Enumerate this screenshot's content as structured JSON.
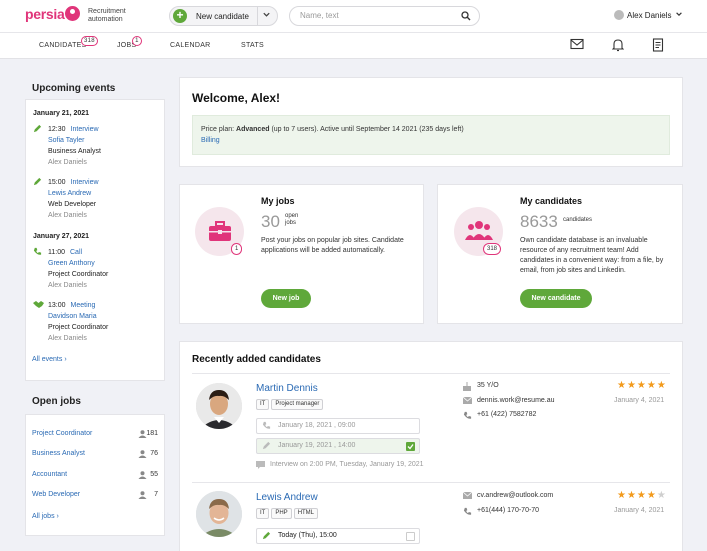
{
  "brand": {
    "logo": "persia",
    "subtitle": "Recruitment automation",
    "color": "#e0357a"
  },
  "header": {
    "new_candidate_label": "New candidate",
    "search_placeholder": "Name, text",
    "user_name": "Alex Daniels"
  },
  "nav": {
    "candidates": {
      "label": "CANDIDATES",
      "badge": "318"
    },
    "jobs": {
      "label": "JOBS",
      "badge": "1"
    },
    "calendar": {
      "label": "CALENDAR"
    },
    "stats": {
      "label": "STATS"
    },
    "icons": [
      "mail-icon",
      "bell-icon",
      "report-icon"
    ]
  },
  "events": {
    "title": "Upcoming events",
    "groups": [
      {
        "date": "January 21, 2021",
        "items": [
          {
            "time": "12:30",
            "type": "Interview",
            "who": "Sofia Tayler",
            "position": "Business Analyst",
            "owner": "Alex Daniels",
            "icon": "pencil-icon"
          },
          {
            "time": "15:00",
            "type": "Interview",
            "who": "Lewis Andrew",
            "position": "Web Developer",
            "owner": "Alex Daniels",
            "icon": "pencil-icon"
          }
        ]
      },
      {
        "date": "January 27, 2021",
        "items": [
          {
            "time": "11:00",
            "type": "Call",
            "who": "Green Anthony",
            "position": "Project Coordinator",
            "owner": "Alex Daniels",
            "icon": "phone-icon"
          },
          {
            "time": "13:00",
            "type": "Meeting",
            "who": "Davidson Maria",
            "position": "Project Coordinator",
            "owner": "Alex Daniels",
            "icon": "handshake-icon"
          }
        ]
      }
    ],
    "all_link": "All events"
  },
  "open_jobs": {
    "title": "Open jobs",
    "items": [
      {
        "name": "Project Coordinator",
        "count": "181"
      },
      {
        "name": "Business Analyst",
        "count": "76"
      },
      {
        "name": "Accountant",
        "count": "55"
      },
      {
        "name": "Web Developer",
        "count": "7"
      }
    ],
    "all_link": "All jobs"
  },
  "welcome": {
    "title": "Welcome, Alex!",
    "plan_prefix": "Price plan: ",
    "plan_name": "Advanced",
    "plan_suffix": " (up to 7 users). Active until September 14 2021 (235 days left)",
    "billing_link": "Billing"
  },
  "my_jobs": {
    "title": "My jobs",
    "count": "30",
    "count_label": "open jobs",
    "badge": "1",
    "description": "Post your jobs on popular job sites. Candidate applications will be added automatically.",
    "button": "New job"
  },
  "my_candidates": {
    "title": "My candidates",
    "count": "8633",
    "count_label": "candidates",
    "badge": "318",
    "description": "Own candidate database is an invaluable resource of any recruitment team! Add candidates in a convenient way: from a file, by email, from job sites and Linkedin.",
    "button": "New candidate"
  },
  "recent": {
    "title": "Recently added candidates",
    "candidates": [
      {
        "name": "Martin Dennis",
        "tags": [
          "IT",
          "Project manager"
        ],
        "event1": "January 18, 2021 , 09:00",
        "event2": "January 19, 2021 , 14:00",
        "event2_done": true,
        "note": "Interview on 2:00 PM, Tuesday, January 19, 2021",
        "age": "35 Y/O",
        "email": "dennis.work@resume.au",
        "phone": "+61 (422) 7582782",
        "rating": 5,
        "date": "January 4, 2021"
      },
      {
        "name": "Lewis Andrew",
        "tags": [
          "IT",
          "PHP",
          "HTML"
        ],
        "event1": "Today (Thu), 15:00",
        "email": "cv.andrew@outlook.com",
        "phone": "+61(444) 170-70-70",
        "rating": 4,
        "date": "January 4, 2021"
      }
    ]
  },
  "colors": {
    "green": "#5fa83a",
    "link": "#2a6ab4",
    "star": "#f29a1c",
    "pink": "#e0357a"
  }
}
